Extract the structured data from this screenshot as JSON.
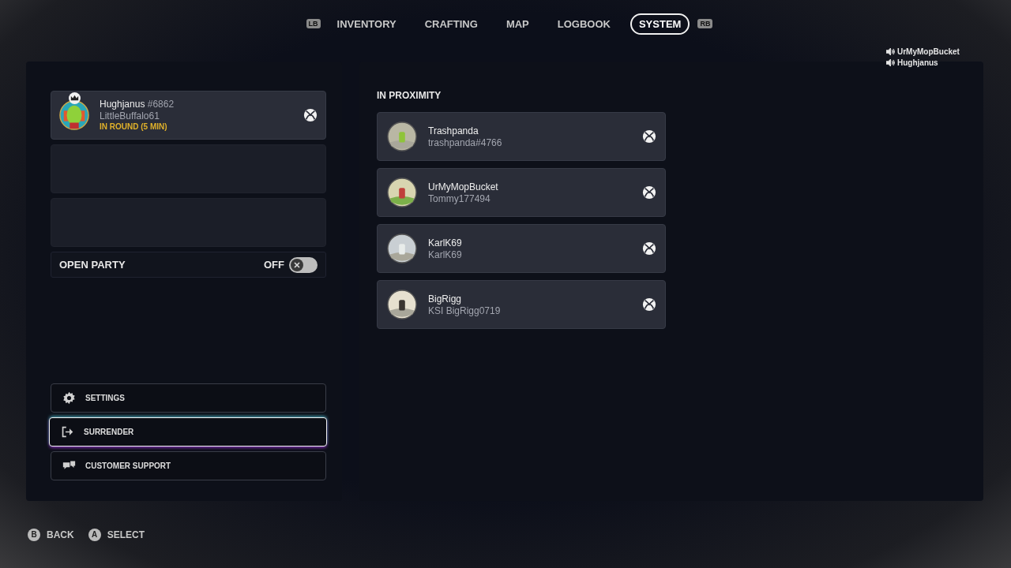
{
  "tabs": {
    "prev_bumper": "LB",
    "next_bumper": "RB",
    "items": [
      {
        "label": "INVENTORY",
        "selected": false
      },
      {
        "label": "CRAFTING",
        "selected": false
      },
      {
        "label": "MAP",
        "selected": false
      },
      {
        "label": "LOGBOOK",
        "selected": false
      },
      {
        "label": "SYSTEM",
        "selected": true
      }
    ]
  },
  "voice_chat": [
    "UrMyMopBucket",
    "Hughjanus"
  ],
  "party": {
    "slots": [
      {
        "kind": "member",
        "name": "Hughjanus",
        "tag": "#6862",
        "gamertag": "LittleBuffalo61",
        "status": "IN ROUND (5 MIN)",
        "leader": true
      },
      {
        "kind": "empty"
      },
      {
        "kind": "empty"
      }
    ],
    "open_party": {
      "label": "OPEN PARTY",
      "state_text": "OFF",
      "on": false
    }
  },
  "menu": [
    {
      "label": "SETTINGS",
      "selected": false
    },
    {
      "label": "SURRENDER",
      "selected": true
    },
    {
      "label": "CUSTOMER SUPPORT",
      "selected": false
    }
  ],
  "proximity": {
    "heading": "IN PROXIMITY",
    "players": [
      {
        "name": "Trashpanda",
        "gamertag": "trashpanda#4766"
      },
      {
        "name": "UrMyMopBucket",
        "gamertag": "Tommy177494"
      },
      {
        "name": "KarlK69",
        "gamertag": "KarlK69"
      },
      {
        "name": "BigRigg",
        "gamertag": "KSI BigRigg0719"
      }
    ]
  },
  "hints": [
    {
      "button": "B",
      "label": "BACK"
    },
    {
      "button": "A",
      "label": "SELECT"
    }
  ]
}
